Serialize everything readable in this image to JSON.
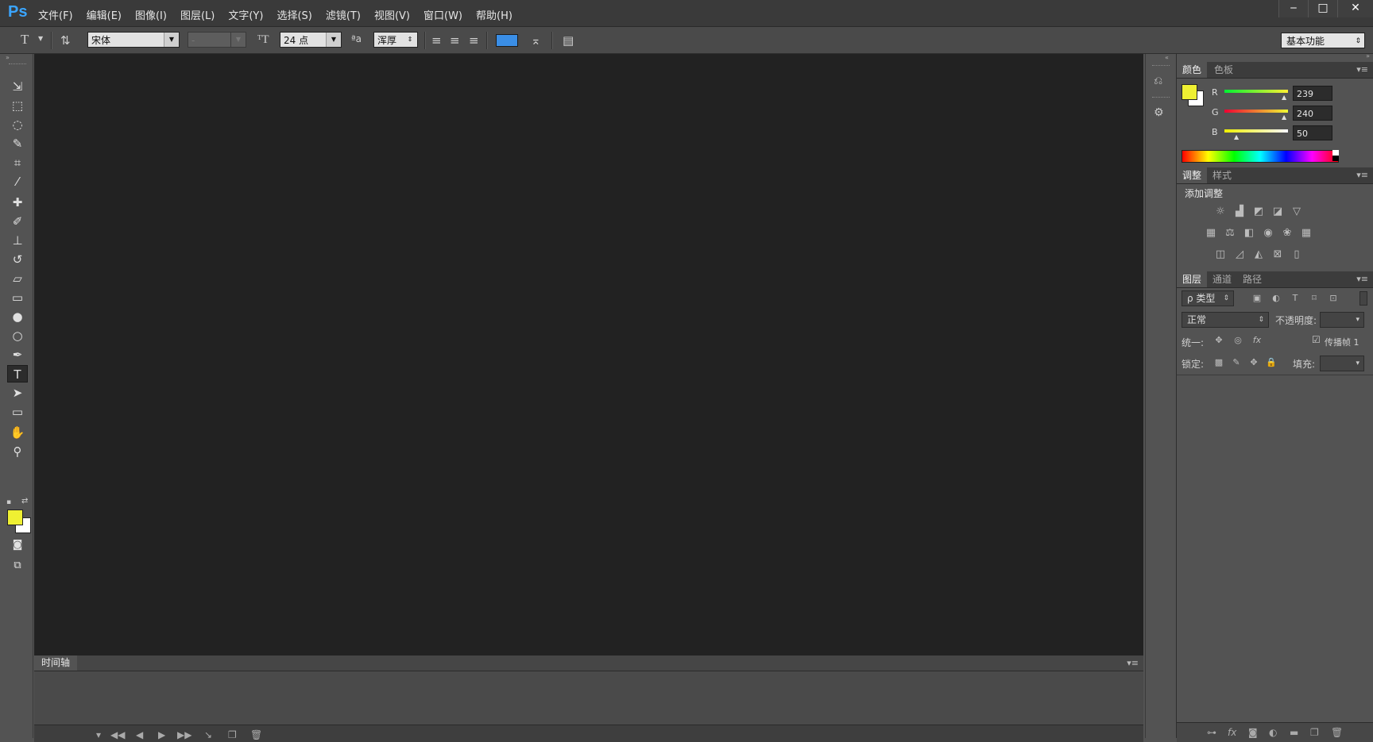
{
  "app": {
    "logo": "Ps"
  },
  "menu": [
    "文件(F)",
    "编辑(E)",
    "图像(I)",
    "图层(L)",
    "文字(Y)",
    "选择(S)",
    "滤镜(T)",
    "视图(V)",
    "窗口(W)",
    "帮助(H)"
  ],
  "window_controls": {
    "minimize": "‒",
    "maximize": "□",
    "close": "✕"
  },
  "options": {
    "tool_glyph": "T",
    "font_family": "宋体",
    "font_style": "-",
    "font_size": "24 点",
    "aa_glyph": "ªa",
    "antialias": "浑厚",
    "text_color": "#3a8ee6",
    "workspace": "基本功能"
  },
  "toolbox": {
    "foreground_color": "#eff032",
    "background_color": "#ffffff",
    "tools": [
      {
        "name": "move-tool-icon",
        "glyph": "⇲"
      },
      {
        "name": "marquee-tool-icon",
        "glyph": "⬚"
      },
      {
        "name": "lasso-tool-icon",
        "glyph": "◌"
      },
      {
        "name": "quick-select-tool-icon",
        "glyph": "✎"
      },
      {
        "name": "crop-tool-icon",
        "glyph": "⌗"
      },
      {
        "name": "eyedropper-tool-icon",
        "glyph": "⁄"
      },
      {
        "name": "healing-brush-tool-icon",
        "glyph": "✚"
      },
      {
        "name": "brush-tool-icon",
        "glyph": "✐"
      },
      {
        "name": "stamp-tool-icon",
        "glyph": "⊥"
      },
      {
        "name": "history-brush-tool-icon",
        "glyph": "↺"
      },
      {
        "name": "eraser-tool-icon",
        "glyph": "▱"
      },
      {
        "name": "gradient-tool-icon",
        "glyph": "▭"
      },
      {
        "name": "blur-tool-icon",
        "glyph": "●"
      },
      {
        "name": "dodge-tool-icon",
        "glyph": "○"
      },
      {
        "name": "pen-tool-icon",
        "glyph": "✒"
      },
      {
        "name": "type-tool-icon",
        "glyph": "T"
      },
      {
        "name": "path-select-tool-icon",
        "glyph": "➤"
      },
      {
        "name": "shape-tool-icon",
        "glyph": "▭"
      },
      {
        "name": "hand-tool-icon",
        "glyph": "✋"
      },
      {
        "name": "zoom-tool-icon",
        "glyph": "⚲"
      }
    ]
  },
  "color_panel": {
    "tabs": [
      "颜色",
      "色板"
    ],
    "fg": "#eff032",
    "bg": "#ffffff",
    "r": {
      "label": "R",
      "value": "239"
    },
    "g": {
      "label": "G",
      "value": "240"
    },
    "b": {
      "label": "B",
      "value": "50"
    }
  },
  "adjust_panel": {
    "tabs": [
      "调整",
      "样式"
    ],
    "heading": "添加调整"
  },
  "layers_panel": {
    "tabs": [
      "图层",
      "通道",
      "路径"
    ],
    "kind": "ρ 类型",
    "blend_mode": "正常",
    "opacity_label": "不透明度:",
    "unify_label": "统一:",
    "propagate_label": "传播帧 1",
    "lock_label": "锁定:",
    "fill_label": "填充:"
  },
  "timeline": {
    "tab": "时间轴"
  }
}
